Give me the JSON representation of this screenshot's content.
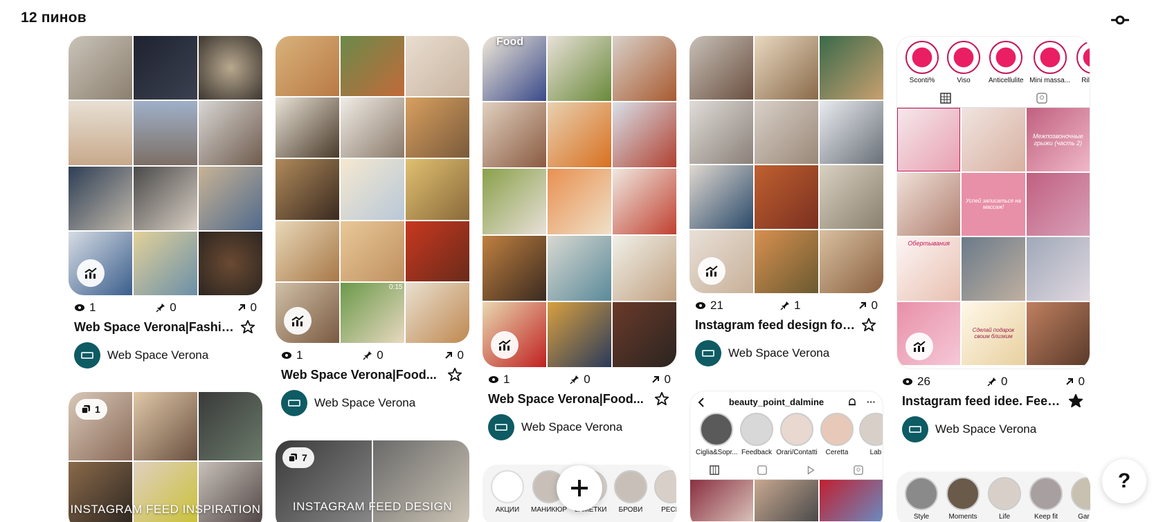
{
  "header": {
    "pin_count": "12 пинов"
  },
  "icons": {
    "filter": "filter-sliders-icon",
    "views": "eye-icon",
    "saves": "pin-icon",
    "outbound": "arrow-up-right-icon",
    "stats": "trend-chart-icon",
    "favorite": "star-icon",
    "add": "plus-icon",
    "help": "question-mark-icon",
    "board_count": "stack-icon"
  },
  "colors": {
    "avatar": "#0e5b63",
    "beauty_accent": "#c2185b"
  },
  "cards": [
    {
      "views": "1",
      "saves": "0",
      "outbound": "0",
      "title": "Web Space Verona|Fashion...",
      "owner": "Web Space Verona",
      "favorited": false
    },
    {
      "views": "1",
      "saves": "0",
      "outbound": "0",
      "title": "Web Space Verona|Food...",
      "owner": "Web Space Verona",
      "favorited": false,
      "video_time": "0:15"
    },
    {
      "views": "1",
      "saves": "0",
      "outbound": "0",
      "title": "Web Space Verona|Food...",
      "owner": "Web Space Verona",
      "favorited": false,
      "cover_label": "Food"
    },
    {
      "views": "21",
      "saves": "1",
      "outbound": "0",
      "title": "Instagram feed design for...",
      "owner": "Web Space Verona",
      "favorited": false
    },
    {
      "views": "26",
      "saves": "0",
      "outbound": "0",
      "title": "Instagram feed idee. Feed...",
      "owner": "Web Space Verona",
      "favorited": true,
      "highlights": [
        "Sconti%",
        "Viso",
        "Anticellulite",
        "Mini massa...",
        "Rilassa"
      ],
      "posts": [
        "Межпозвоночные грыжи (часть 2)",
        "Успей записаться на массаж!",
        "Обертывания",
        "Сделай подарок своим близким"
      ]
    }
  ],
  "bottom_cards": [
    {
      "count": "1",
      "label": "INSTAGRAM FEED INSPIRATION"
    },
    {
      "count": "7",
      "label": "INSTAGRAM FEED DESIGN"
    },
    {
      "highlights": [
        "АКЦИИ",
        "МАНИКЮР",
        "ЗАМЕТКИ",
        "БРОВИ",
        "РЕСН"
      ]
    },
    {
      "handle": "beauty_point_dalmine",
      "highlights": [
        "Ciglia&Sopr...",
        "Feedback",
        "Orari/Contatti",
        "Ceretta",
        "Lab"
      ]
    },
    {
      "highlights": [
        "Style",
        "Moments",
        "Life",
        "Keep fit",
        "Garda"
      ]
    }
  ],
  "help_label": "?"
}
